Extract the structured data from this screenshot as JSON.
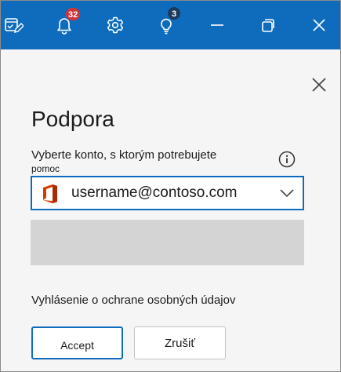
{
  "titlebar": {
    "icons": [
      "task-edit-icon",
      "bell-icon",
      "gear-icon",
      "lightbulb-icon",
      "minimize-icon",
      "restore-icon",
      "close-icon"
    ],
    "notifications_count": "32",
    "tips_count": "3",
    "background_color": "#0f6cbd",
    "notification_badge_color": "#d13438"
  },
  "panel": {
    "title": "Podpora",
    "select_label_line1": "Vyberte konto, s ktorým potrebujete",
    "select_label_line2": "pomoc",
    "info_icon": "info-icon",
    "account": {
      "value": "username@contoso.com",
      "logo": "office-logo-icon"
    },
    "privacy_text": "Vyhlásenie o ochrane osobných údajov",
    "accept_label": "Accept",
    "cancel_label": "Zrušiť",
    "accent_color": "#0f6cbd"
  }
}
